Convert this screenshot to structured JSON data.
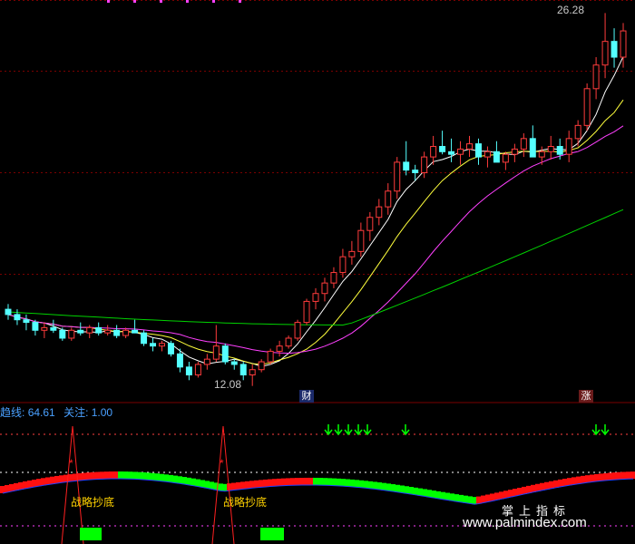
{
  "labels": {
    "high": "26.28",
    "low": "12.08",
    "badge_cai": "财",
    "badge_zhang": "涨",
    "signal": "战略抄底",
    "watermark_cn": "掌上指标",
    "watermark_url": "www.palmindex.com"
  },
  "legend": {
    "line_label": "趋线:",
    "line_value": "64.61",
    "focus_label": "关注:",
    "focus_value": "1.00"
  },
  "colors": {
    "up": "#ff3c3c",
    "down": "#54ffff",
    "ma5": "#ffffff",
    "ma10": "#ffff3c",
    "ma20": "#ff40ff",
    "ma60": "#00d200",
    "blue": "#2040ff",
    "green": "#00ff00"
  },
  "chart_data": {
    "type": "candlestick",
    "candles": [
      [
        15.0,
        15.2,
        14.6,
        14.8
      ],
      [
        14.8,
        15.0,
        14.4,
        14.6
      ],
      [
        14.6,
        14.8,
        14.2,
        14.5
      ],
      [
        14.5,
        14.6,
        14.0,
        14.2
      ],
      [
        14.2,
        14.5,
        13.9,
        14.3
      ],
      [
        14.3,
        14.6,
        14.1,
        14.2
      ],
      [
        14.2,
        14.3,
        13.8,
        13.9
      ],
      [
        13.9,
        14.3,
        13.8,
        14.2
      ],
      [
        14.2,
        14.5,
        14.0,
        14.1
      ],
      [
        14.1,
        14.4,
        13.9,
        14.3
      ],
      [
        14.3,
        14.5,
        14.0,
        14.1
      ],
      [
        14.1,
        14.4,
        14.0,
        14.2
      ],
      [
        14.2,
        14.4,
        13.9,
        14.0
      ],
      [
        14.0,
        14.3,
        13.9,
        14.2
      ],
      [
        14.2,
        14.6,
        14.1,
        14.1
      ],
      [
        14.1,
        14.2,
        13.6,
        13.7
      ],
      [
        13.7,
        13.9,
        13.4,
        13.6
      ],
      [
        13.6,
        13.8,
        13.4,
        13.7
      ],
      [
        13.7,
        13.8,
        13.2,
        13.3
      ],
      [
        13.3,
        13.5,
        12.6,
        12.8
      ],
      [
        12.8,
        13.0,
        12.3,
        12.5
      ],
      [
        12.5,
        13.0,
        12.4,
        12.9
      ],
      [
        12.9,
        13.3,
        12.7,
        13.1
      ],
      [
        13.1,
        14.4,
        13.0,
        13.6
      ],
      [
        13.6,
        13.7,
        12.9,
        13.0
      ],
      [
        13.0,
        13.1,
        12.7,
        12.9
      ],
      [
        12.9,
        13.0,
        12.3,
        12.5
      ],
      [
        12.5,
        12.9,
        12.08,
        12.7
      ],
      [
        12.7,
        13.1,
        12.6,
        13.0
      ],
      [
        13.0,
        13.5,
        12.9,
        13.4
      ],
      [
        13.4,
        13.8,
        13.2,
        13.6
      ],
      [
        13.6,
        14.0,
        13.5,
        13.9
      ],
      [
        13.9,
        14.6,
        13.8,
        14.5
      ],
      [
        14.5,
        15.4,
        14.4,
        15.3
      ],
      [
        15.3,
        15.8,
        15.0,
        15.6
      ],
      [
        15.6,
        16.2,
        15.3,
        16.0
      ],
      [
        16.0,
        16.6,
        15.8,
        16.4
      ],
      [
        16.4,
        17.3,
        16.2,
        17.0
      ],
      [
        17.0,
        17.6,
        16.7,
        17.2
      ],
      [
        17.2,
        18.3,
        17.0,
        18.0
      ],
      [
        18.0,
        18.7,
        17.6,
        18.5
      ],
      [
        18.5,
        19.2,
        18.2,
        18.9
      ],
      [
        18.9,
        19.8,
        18.6,
        19.5
      ],
      [
        19.5,
        20.8,
        19.2,
        20.6
      ],
      [
        20.6,
        21.4,
        20.1,
        20.3
      ],
      [
        20.3,
        20.5,
        19.9,
        20.2
      ],
      [
        20.2,
        21.0,
        20.0,
        20.8
      ],
      [
        20.8,
        21.6,
        20.5,
        21.2
      ],
      [
        21.2,
        21.8,
        20.9,
        21.0
      ],
      [
        21.0,
        21.5,
        20.6,
        20.9
      ],
      [
        20.9,
        21.4,
        20.5,
        21.1
      ],
      [
        21.1,
        21.6,
        20.8,
        21.3
      ],
      [
        21.3,
        21.5,
        20.5,
        20.8
      ],
      [
        20.8,
        21.2,
        20.4,
        21.0
      ],
      [
        21.0,
        21.4,
        20.6,
        20.6
      ],
      [
        20.6,
        21.0,
        20.3,
        20.9
      ],
      [
        20.9,
        21.3,
        20.6,
        21.1
      ],
      [
        21.1,
        21.7,
        20.8,
        21.5
      ],
      [
        21.5,
        22.0,
        21.2,
        20.8
      ],
      [
        20.8,
        21.2,
        20.5,
        21.0
      ],
      [
        21.0,
        21.6,
        20.7,
        21.2
      ],
      [
        21.2,
        21.5,
        20.7,
        20.9
      ],
      [
        20.9,
        21.8,
        20.6,
        21.5
      ],
      [
        21.5,
        22.2,
        21.2,
        22.0
      ],
      [
        22.0,
        23.6,
        21.8,
        23.4
      ],
      [
        23.4,
        24.6,
        23.0,
        24.3
      ],
      [
        24.3,
        26.28,
        23.8,
        25.2
      ],
      [
        25.2,
        25.7,
        24.2,
        24.6
      ],
      [
        24.6,
        25.9,
        24.2,
        25.6
      ]
    ]
  }
}
